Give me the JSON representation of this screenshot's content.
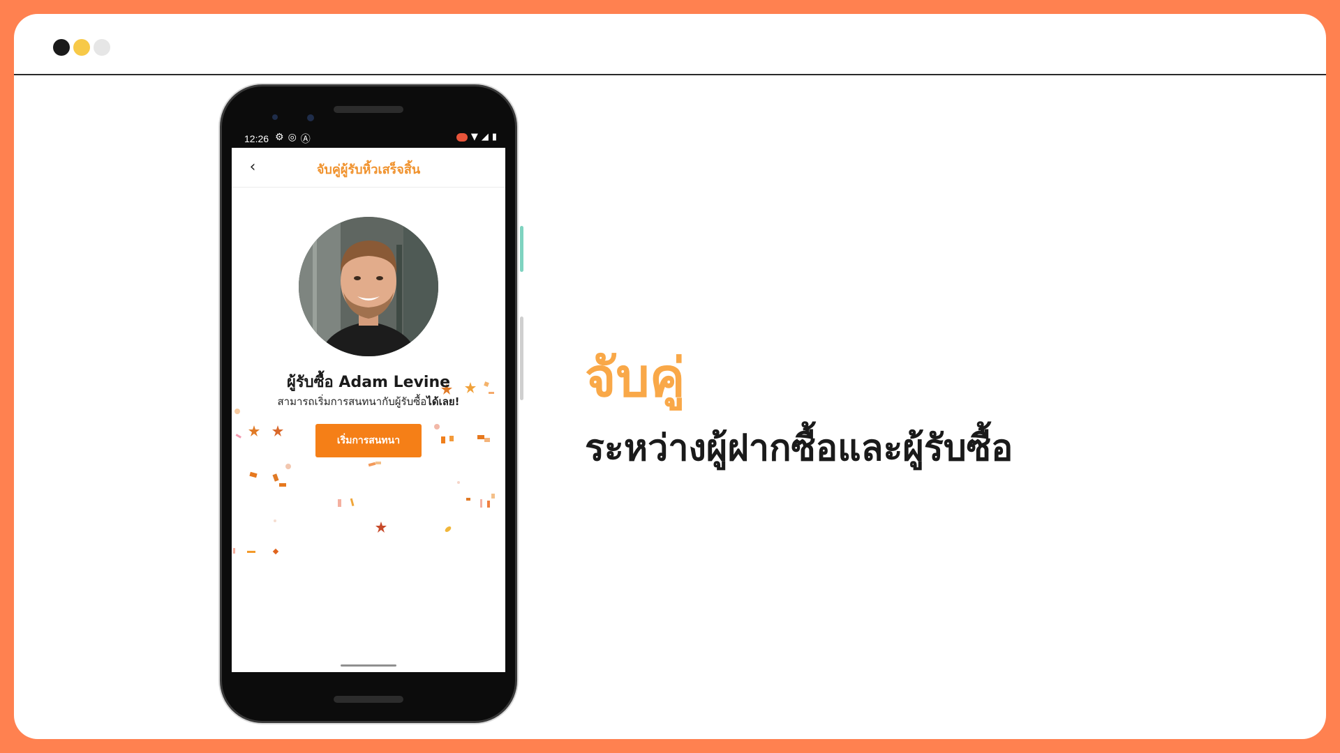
{
  "colors": {
    "frame_orange": "#ff8150",
    "dot_black": "#1a1a1a",
    "dot_yellow": "#f7c948",
    "dot_light": "#e6e6e6",
    "accent_orange": "#f57f17",
    "headline_orange": "#f9a848"
  },
  "phone": {
    "status": {
      "time": "12:26",
      "left_icons": [
        "settings-icon",
        "target-icon",
        "app-icon"
      ],
      "right_icons": [
        "record-icon",
        "wifi-icon",
        "signal-icon",
        "battery-icon"
      ]
    },
    "appbar": {
      "back_icon": "chevron-left-icon",
      "title": "จับคู่ผู้รับหิ้วเสร็จสิ้น"
    },
    "match": {
      "name": "ผู้รับซื้อ Adam Levine",
      "subtitle_prefix": "สามารถเริ่มการสนทนากับผู้รับซื้อ",
      "subtitle_emphasis": "ได้เลย!",
      "button_label": "เริ่มการสนทนา"
    }
  },
  "headline": "จับคู่",
  "subheadline": "ระหว่างผู้ฝากซื้อและผู้รับซื้อ"
}
